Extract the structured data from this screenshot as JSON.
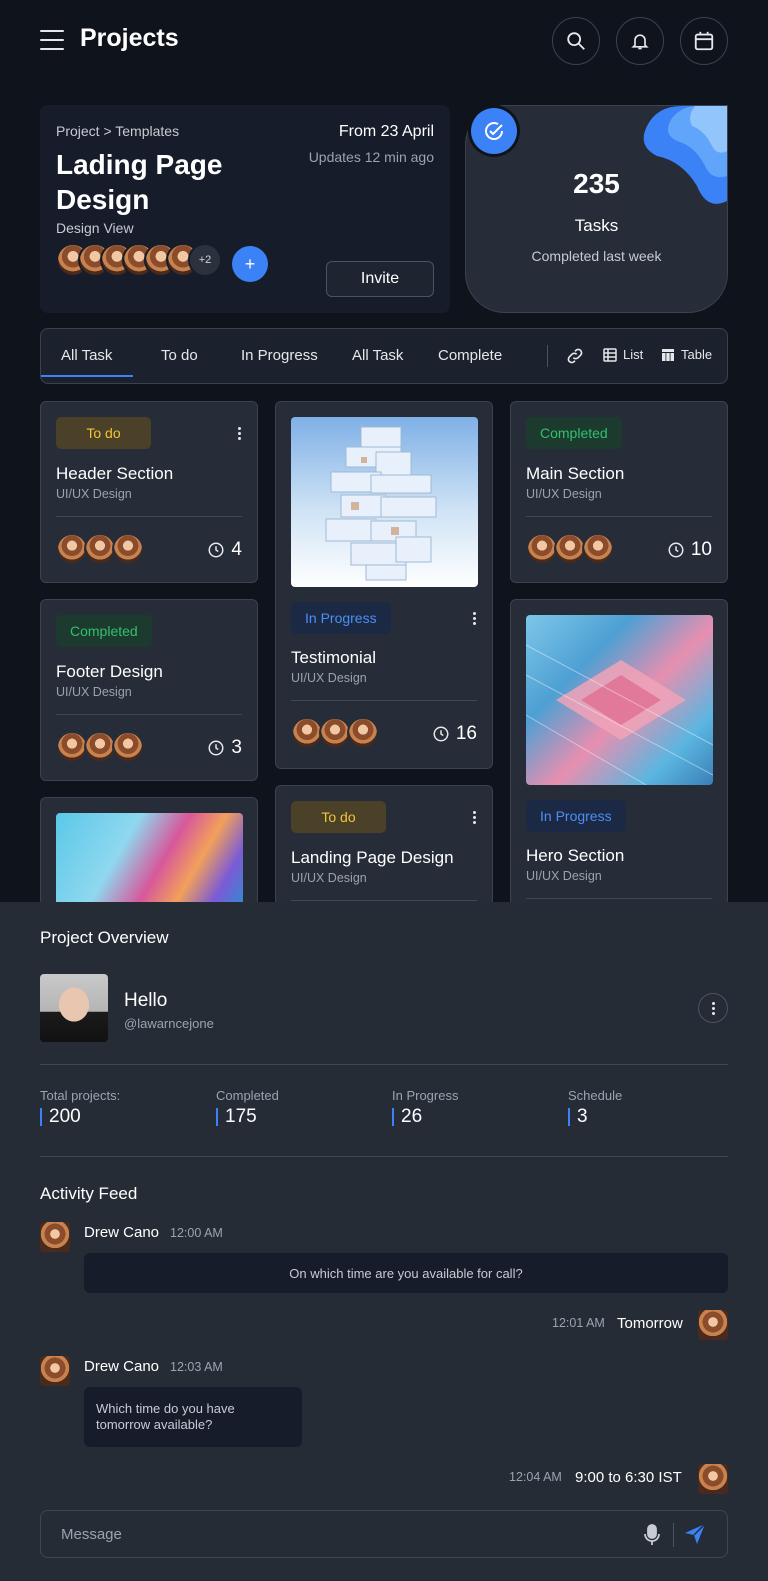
{
  "header": {
    "title": "Projects",
    "icons": [
      "menu-icon",
      "search-icon",
      "bell-icon",
      "calendar-icon"
    ]
  },
  "project": {
    "breadcrumb": "Project > Templates",
    "title": "Lading Page Design",
    "subtitle": "Design View",
    "from": "From 23 April",
    "updates": "Updates 12 min ago",
    "more_members": "+2",
    "add_label": "+",
    "invite_label": "Invite"
  },
  "tasks_summary": {
    "count": "235",
    "label": "Tasks",
    "caption": "Completed last week"
  },
  "tabs": [
    "All Task",
    "To do",
    "In Progress",
    "All Task",
    "Complete"
  ],
  "view_options": {
    "list": "List",
    "table": "Table"
  },
  "cards": [
    {
      "status": "To do",
      "title": "Header Section",
      "category": "UI/UX Design",
      "count": "4"
    },
    {
      "status": "In Progress",
      "title": "Testimonial",
      "category": "UI/UX Design",
      "count": "16"
    },
    {
      "status": "Completed",
      "title": "Main Section",
      "category": "UI/UX Design",
      "count": "10"
    },
    {
      "status": "Completed",
      "title": "Footer Design",
      "category": "UI/UX Design",
      "count": "3"
    },
    {
      "status": "In Progress",
      "title": "Hero Section",
      "category": "UI/UX Design"
    },
    {
      "status": "To do",
      "title": "Landing Page Design",
      "category": "UI/UX Design"
    }
  ],
  "colors": {
    "accent": "#3b82f6",
    "todo": "#f0c53a",
    "completed": "#2fc26d",
    "in_progress": "#4b8ef5"
  },
  "overview": {
    "title": "Project Overview",
    "greeting": "Hello",
    "handle": "@lawarncejone",
    "stats": [
      {
        "label": "Total projects:",
        "value": "200"
      },
      {
        "label": "Completed",
        "value": "175"
      },
      {
        "label": "In Progress",
        "value": "26"
      },
      {
        "label": "Schedule",
        "value": "3"
      }
    ]
  },
  "activity": {
    "title": "Activity Feed",
    "messages": [
      {
        "name": "Drew Cano",
        "time": "12:00 AM",
        "text": "On which time are you available for call?"
      },
      {
        "reply": "Tomorrow",
        "time": "12:01 AM"
      },
      {
        "name": "Drew Cano",
        "time": "12:03 AM",
        "text": "Which time do you have tomorrow available?"
      },
      {
        "reply": "9:00 to 6:30 IST",
        "time": "12:04 AM"
      }
    ]
  },
  "composer": {
    "placeholder": "Message"
  }
}
